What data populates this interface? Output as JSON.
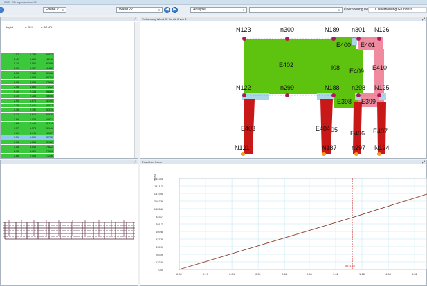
{
  "app": {
    "title": "SXS - 3D Ingenieurbau 14"
  },
  "toolbar": {
    "level_select": "Ebene 2",
    "wall_select": "Wand 22",
    "analysis_select": "Analyse",
    "ueberhoehung_label": "Überhöhung Wände",
    "ueberhoehung_value": "1.0: Überhöhung Grundriss"
  },
  "table_panel": {
    "columns": [
      "dny/dt",
      "σ SLU",
      "σ PGADL"
    ],
    "rows": [
      [
        "7.67",
        "2.788",
        "6.923",
        "#3cc83c"
      ],
      [
        "2.42",
        "1.680",
        "4.246",
        "#3cc83c"
      ],
      [
        "5.14",
        "2.560",
        "6.399",
        "#3cc83c"
      ],
      [
        "2.00",
        "1.767",
        "4.482",
        "#3cc83c"
      ],
      [
        "2.55",
        "2.364",
        "5.966",
        "#3cc83c"
      ],
      [
        "2.44",
        "2.308",
        "5.771",
        "#3cc83c"
      ],
      [
        "3.05",
        "3.035",
        "7.586",
        "#3cc83c"
      ],
      [
        "2.58",
        "3.889",
        "7.222",
        "#3cc83c"
      ],
      [
        "5.40",
        "2.346",
        "5.866",
        "#3cc83c"
      ],
      [
        "5.30",
        "2.243",
        "5.606",
        "#3cc83c"
      ],
      [
        "2.50",
        "1.676",
        "4.190",
        "#3cc83c"
      ],
      [
        "2.16",
        "1.611",
        "4.027",
        "#3cc83c"
      ],
      [
        "2.36",
        "2.152",
        "5.375",
        "#3cc83c"
      ],
      [
        "5.12",
        "2.610",
        "6.526",
        "#3cc83c"
      ],
      [
        "1.96",
        "1.933",
        "4.831",
        "#3cc83c"
      ],
      [
        "4.69",
        "2.446",
        "6.114",
        "#3cc83c"
      ],
      [
        "1.57",
        "1.578",
        "3.946",
        "#3cc83c"
      ],
      [
        "1.61",
        "1.611",
        "4.027",
        "#3cc83c"
      ],
      [
        "1.51",
        "1.509",
        "3.772",
        "#8fc8f0"
      ],
      [
        "1.38",
        "1.583",
        "3.962",
        "#3cc83c"
      ],
      [
        "3.08",
        "3.049",
        "7.622",
        "#3cc83c"
      ],
      [
        "2.05",
        "3.021",
        "7.553",
        "#3cc83c"
      ],
      [
        "2.86",
        "2.903",
        "7.256",
        "#3cc83c"
      ],
      [
        "1.86",
        "2.908",
        "7.270",
        "#3cc83c"
      ]
    ]
  },
  "wall_panel": {
    "title": "Verformung Wand 22 Schritt 2 von 3",
    "nodes": [
      "N123",
      "n300",
      "N189",
      "n301",
      "N126",
      "N122",
      "n299",
      "N188",
      "n298",
      "N125",
      "N121",
      "N187",
      "n297",
      "N124"
    ],
    "elements": [
      "E402",
      "E400",
      "E401",
      "E409",
      "E410",
      "E398",
      "E399",
      "E403",
      "E404",
      "E406",
      "E407",
      "i08",
      "05"
    ]
  },
  "pushover_panel": {
    "title": "PushOver Kurve",
    "y_label": "V[kN]",
    "y_ticks": [
      "1543.4",
      "1411.2",
      "1319.5",
      "2187.8",
      "1555.6",
      "923.7",
      "791.7",
      "659.8",
      "527.8",
      "395.9",
      "263.9",
      "132.0",
      "0.0"
    ],
    "x_ticks": [
      "0.00",
      "0.17",
      "0.34",
      "0.51",
      "0.68",
      "0.84",
      "1.01",
      "1.18",
      "1.35",
      "1.52"
    ],
    "marker_label": "dx=1.12"
  },
  "chart_data": {
    "type": "line",
    "title": "PushOver Kurve",
    "xlabel": "",
    "ylabel": "V[kN]",
    "x": [
      0.0,
      1.12,
      1.6
    ],
    "series": [
      {
        "values": [
          0.0,
          880.0,
          1275.0
        ]
      }
    ],
    "xlim": [
      0.0,
      1.6
    ],
    "ylim": [
      0.0,
      1543.4
    ],
    "marker_x": 1.12,
    "grid": true,
    "line_color": "#8b3a2a",
    "marker_color": "#d04040"
  },
  "colors": {
    "green": "#5ec30f",
    "red": "#c81818",
    "pink": "#f08a9e",
    "lightblue": "#a9d7e8",
    "node": "#b0175a"
  }
}
